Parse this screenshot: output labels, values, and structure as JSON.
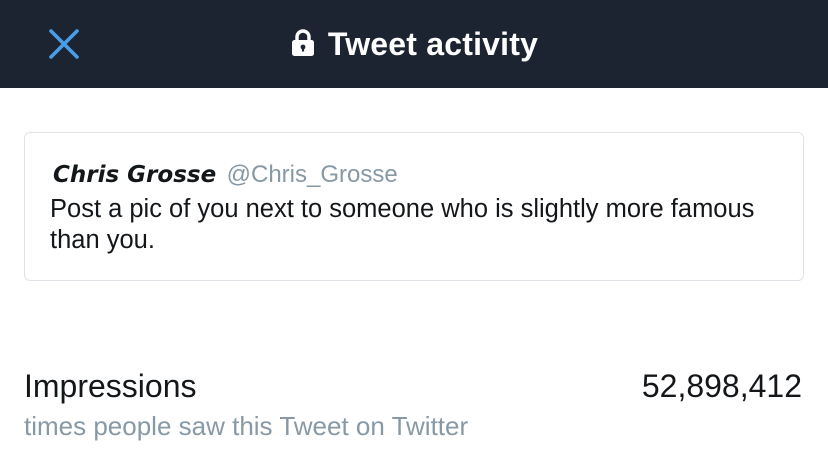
{
  "header": {
    "title": "Tweet activity",
    "close_icon": "close-icon",
    "lock_icon": "lock-icon",
    "background_color": "#1c2431",
    "accent_color": "#4a9ee8"
  },
  "tweet": {
    "author_name": "Chris Grosse",
    "author_handle": "@Chris_Grosse",
    "text": "Post a pic of you next to someone who is slightly more famous than you."
  },
  "metrics": {
    "impressions": {
      "label": "Impressions",
      "value": "52,898,412",
      "description": "times people saw this Tweet on Twitter"
    }
  }
}
